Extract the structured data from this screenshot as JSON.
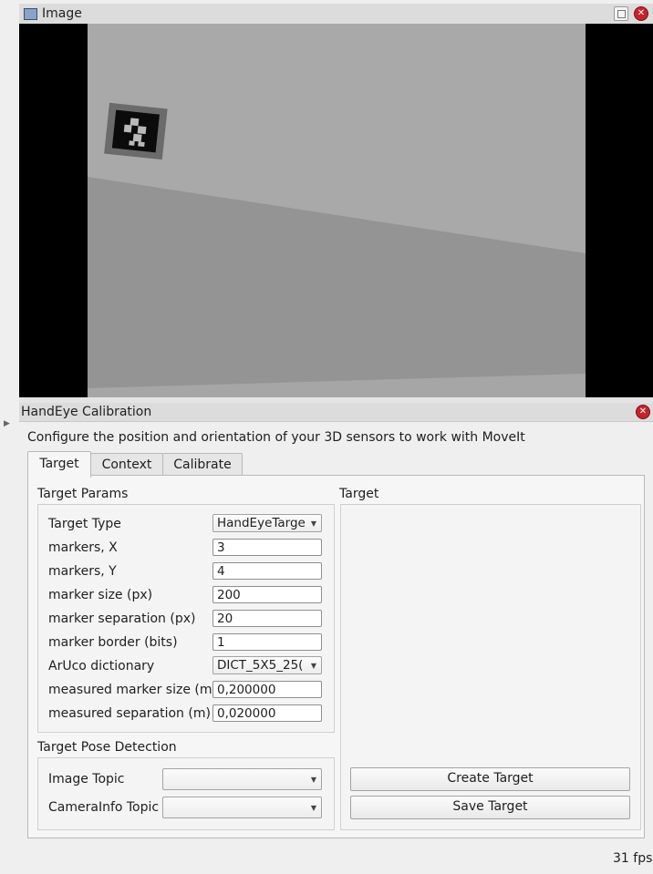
{
  "image_dock": {
    "title": "Image",
    "icon": "image-icon"
  },
  "handeye": {
    "title": "HandEye Calibration",
    "description": "Configure the position and orientation of your 3D sensors to work with MoveIt",
    "tabs": [
      {
        "label": "Target",
        "active": true
      },
      {
        "label": "Context",
        "active": false
      },
      {
        "label": "Calibrate",
        "active": false
      }
    ],
    "target_params": {
      "title": "Target Params",
      "rows": [
        {
          "label": "Target Type",
          "value": "HandEyeTarge",
          "kind": "combo"
        },
        {
          "label": "markers, X",
          "value": "3",
          "kind": "field"
        },
        {
          "label": "markers, Y",
          "value": "4",
          "kind": "field"
        },
        {
          "label": "marker size (px)",
          "value": "200",
          "kind": "field"
        },
        {
          "label": "marker separation (px)",
          "value": "20",
          "kind": "field"
        },
        {
          "label": "marker border (bits)",
          "value": "1",
          "kind": "field"
        },
        {
          "label": "ArUco dictionary",
          "value": "DICT_5X5_25(",
          "kind": "combo"
        },
        {
          "label": "measured marker size (m)",
          "value": "0,200000",
          "kind": "field"
        },
        {
          "label": "measured separation (m)",
          "value": "0,020000",
          "kind": "field"
        }
      ]
    },
    "pose_detection": {
      "title": "Target Pose Detection",
      "image_topic_label": "Image Topic",
      "image_topic_value": "",
      "camerainfo_topic_label": "CameraInfo Topic",
      "camerainfo_topic_value": ""
    },
    "target_preview": {
      "title": "Target"
    },
    "create_target_label": "Create Target",
    "save_target_label": "Save Target"
  },
  "status": {
    "fps": "31 fps"
  },
  "colors": {
    "close_button": "#c5232b",
    "image_wall": "#a9a9a9",
    "image_floor": "#949494"
  }
}
